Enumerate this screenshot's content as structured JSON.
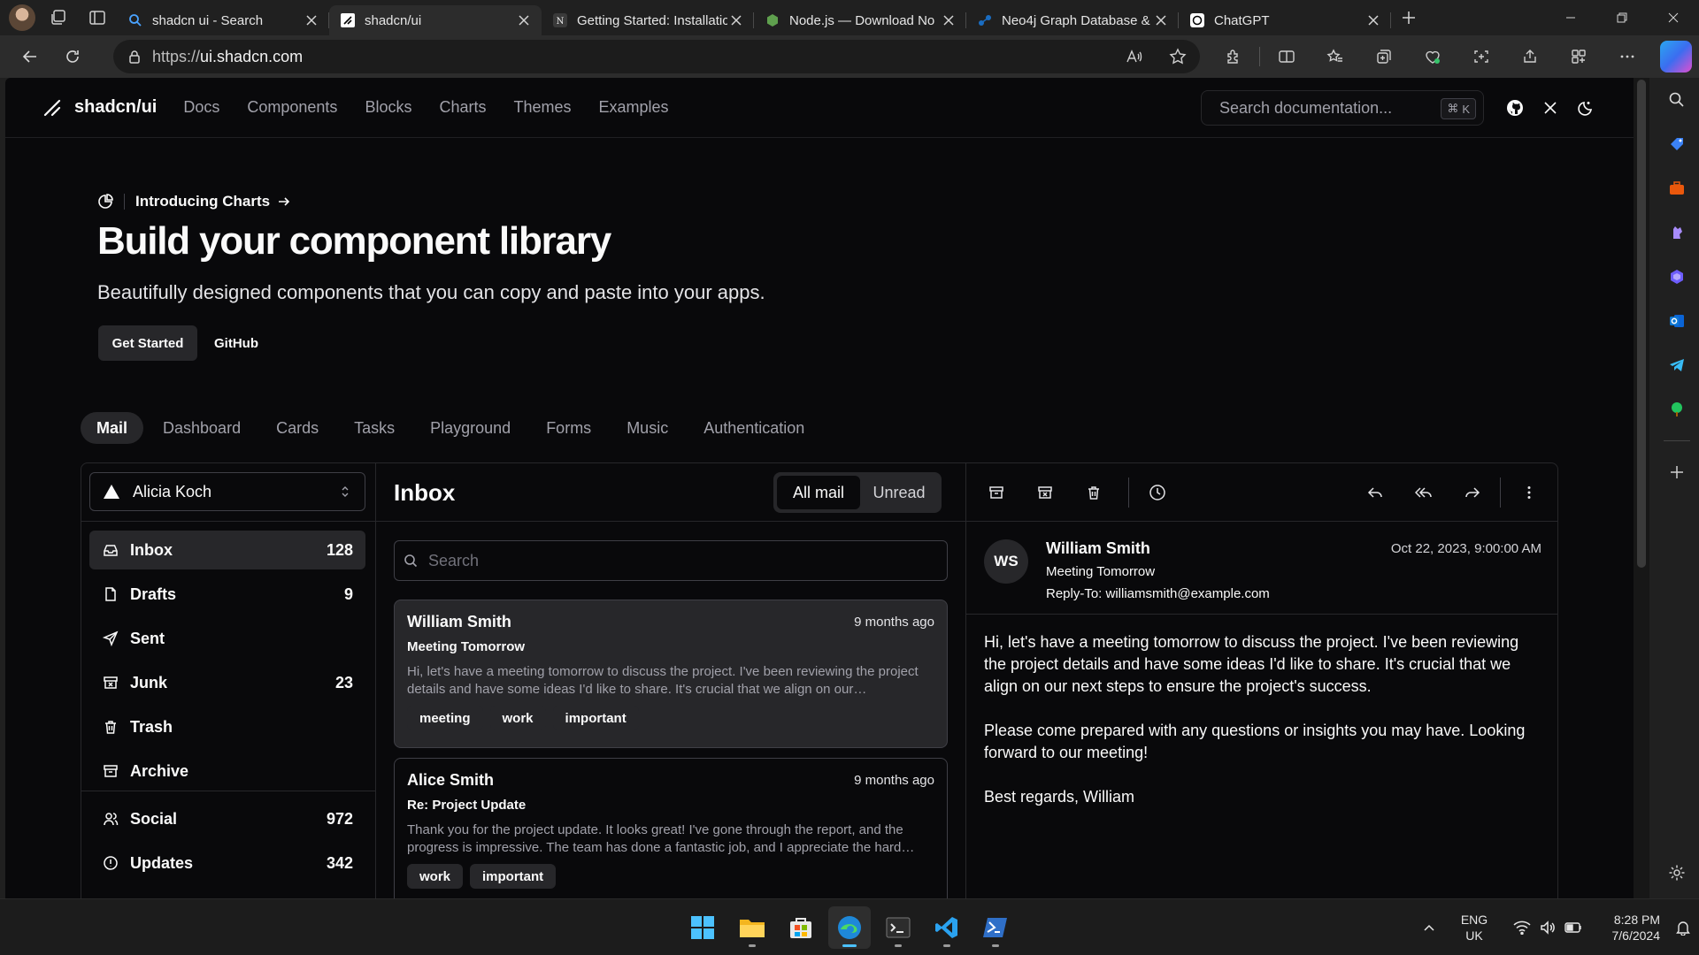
{
  "browser": {
    "tabs": [
      {
        "title": "shadcn ui - Search",
        "icon": "search-icon",
        "active": false
      },
      {
        "title": "shadcn/ui",
        "icon": "shadcn-favicon",
        "active": true
      },
      {
        "title": "Getting Started: Installatio",
        "icon": "notion-favicon",
        "active": false
      },
      {
        "title": "Node.js — Download No",
        "icon": "nodejs-favicon",
        "active": false
      },
      {
        "title": "Neo4j Graph Database &",
        "icon": "neo4j-favicon",
        "active": false
      },
      {
        "title": "ChatGPT",
        "icon": "chatgpt-favicon",
        "active": false
      }
    ],
    "url_prefix": "https://",
    "url_host": "ui.shadcn.com"
  },
  "site": {
    "brand": "shadcn/ui",
    "nav": [
      "Docs",
      "Components",
      "Blocks",
      "Charts",
      "Themes",
      "Examples"
    ],
    "search_placeholder": "Search documentation...",
    "search_kbd_symbol": "⌘",
    "search_kbd_key": "K"
  },
  "hero": {
    "announcement": "Introducing Charts",
    "title": "Build your component library",
    "subtitle": "Beautifully designed components that you can copy and paste into your apps.",
    "primary_cta": "Get Started",
    "secondary_cta": "GitHub"
  },
  "example_tabs": [
    "Mail",
    "Dashboard",
    "Cards",
    "Tasks",
    "Playground",
    "Forms",
    "Music",
    "Authentication"
  ],
  "mail": {
    "account": "Alicia Koch",
    "folders": [
      {
        "label": "Inbox",
        "count": "128",
        "icon": "inbox-icon",
        "active": true
      },
      {
        "label": "Drafts",
        "count": "9",
        "icon": "file-icon",
        "active": false
      },
      {
        "label": "Sent",
        "count": "",
        "icon": "send-icon",
        "active": false
      },
      {
        "label": "Junk",
        "count": "23",
        "icon": "archive-x-icon",
        "active": false
      },
      {
        "label": "Trash",
        "count": "",
        "icon": "trash-icon",
        "active": false
      },
      {
        "label": "Archive",
        "count": "",
        "icon": "archive-icon",
        "active": false
      }
    ],
    "categories": [
      {
        "label": "Social",
        "count": "972",
        "icon": "users-icon"
      },
      {
        "label": "Updates",
        "count": "342",
        "icon": "alert-circle-icon"
      }
    ],
    "inbox_title": "Inbox",
    "filter_all": "All mail",
    "filter_unread": "Unread",
    "search_placeholder": "Search",
    "messages": [
      {
        "from": "William Smith",
        "date": "9 months ago",
        "subject": "Meeting Tomorrow",
        "preview": "Hi, let's have a meeting tomorrow to discuss the project. I've been reviewing the project details and have some ideas I'd like to share. It's crucial that we align on our…",
        "tags": [
          "meeting",
          "work",
          "important"
        ]
      },
      {
        "from": "Alice Smith",
        "date": "9 months ago",
        "subject": "Re: Project Update",
        "preview": "Thank you for the project update. It looks great! I've gone through the report, and the progress is impressive. The team has done a fantastic job, and I appreciate the hard…",
        "tags": [
          "work",
          "important"
        ]
      }
    ],
    "reader": {
      "initials": "WS",
      "from": "William Smith",
      "subject": "Meeting Tomorrow",
      "reply_to": "Reply-To: williamsmith@example.com",
      "date": "Oct 22, 2023, 9:00:00 AM",
      "body": [
        "Hi, let's have a meeting tomorrow to discuss the project. I've been reviewing the project details and have some ideas I'd like to share. It's crucial that we align on our next steps to ensure the project's success.",
        "Please come prepared with any questions or insights you may have. Looking forward to our meeting!",
        "Best regards, William"
      ]
    }
  },
  "taskbar": {
    "language": "ENG",
    "region": "UK",
    "time": "8:28 PM",
    "date": "7/6/2024"
  },
  "colors": {
    "page_bg": "#09090b",
    "muted": "#27272a",
    "border": "#27272a",
    "text": "#fafafa",
    "muted_text": "#a1a1aa",
    "edge_accent": "#4cc2ff"
  }
}
